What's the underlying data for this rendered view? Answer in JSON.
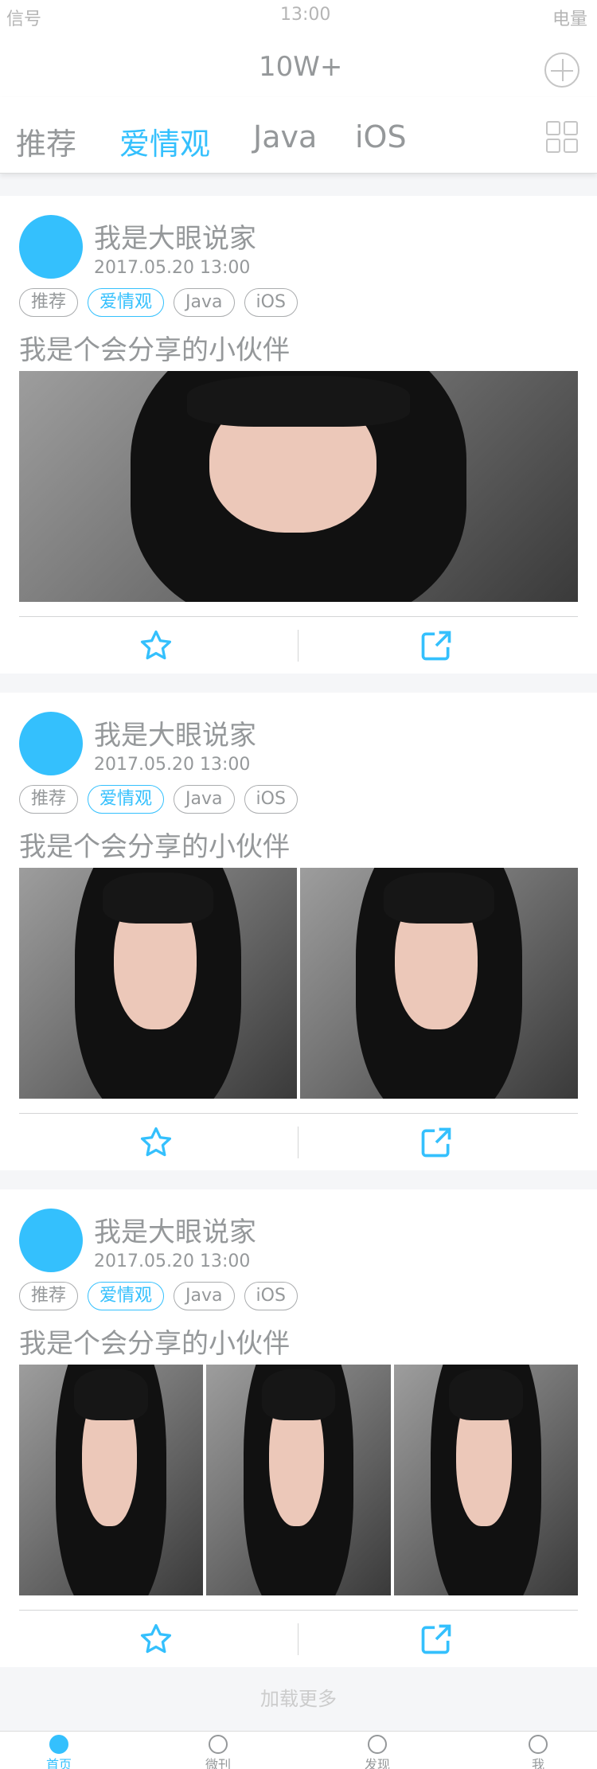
{
  "status": {
    "signal": "信号",
    "time": "13:00",
    "battery": "电量"
  },
  "header": {
    "count": "10W+"
  },
  "tabs": [
    {
      "label": "推荐"
    },
    {
      "label": "爱情观",
      "active": true
    },
    {
      "label": "Java"
    },
    {
      "label": "iOS"
    }
  ],
  "posts": [
    {
      "author": "我是大眼说家",
      "time": "2017.05.20   13:00",
      "tags": [
        "推荐",
        "爱情观",
        "Java",
        "iOS"
      ],
      "content": "我是个会分享的小伙伴",
      "photos": 1
    },
    {
      "author": "我是大眼说家",
      "time": "2017.05.20   13:00",
      "tags": [
        "推荐",
        "爱情观",
        "Java",
        "iOS"
      ],
      "content": "我是个会分享的小伙伴",
      "photos": 2
    },
    {
      "author": "我是大眼说家",
      "time": "2017.05.20   13:00",
      "tags": [
        "推荐",
        "爱情观",
        "Java",
        "iOS"
      ],
      "content": "我是个会分享的小伙伴",
      "photos": 3
    }
  ],
  "load_more": "加载更多",
  "nav": [
    {
      "label": "首页",
      "icon": "home-icon",
      "active": true
    },
    {
      "label": "微刊",
      "icon": "book-icon"
    },
    {
      "label": "发现",
      "icon": "eye-icon"
    },
    {
      "label": "我",
      "icon": "user-icon"
    }
  ],
  "colors": {
    "accent": "#34c0fd",
    "text": "#95989a",
    "border": "#aaacae",
    "divider": "#d4d5d6",
    "bg": "#f5f6f8"
  }
}
